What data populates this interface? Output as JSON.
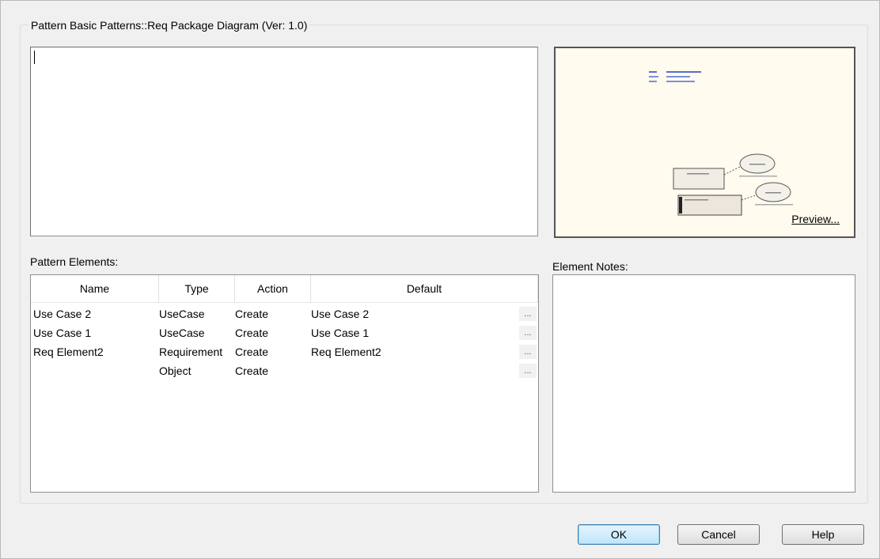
{
  "group": {
    "title": "Pattern Basic Patterns::Req Package Diagram (Ver: 1.0)"
  },
  "notes": {
    "value": ""
  },
  "preview": {
    "link_label": "Preview..."
  },
  "pattern_elements": {
    "label": "Pattern Elements:",
    "columns": [
      "Name",
      "Type",
      "Action",
      "Default"
    ],
    "rows": [
      {
        "name": "Use Case 2",
        "type": "UseCase",
        "action": "Create",
        "default": "Use Case 2",
        "more": "..."
      },
      {
        "name": "Use Case 1",
        "type": "UseCase",
        "action": "Create",
        "default": "Use Case 1",
        "more": "..."
      },
      {
        "name": "Req Element2",
        "type": "Requirement",
        "action": "Create",
        "default": "Req Element2",
        "more": "..."
      },
      {
        "name": "",
        "type": "Object",
        "action": "Create",
        "default": "",
        "more": "..."
      }
    ]
  },
  "element_notes": {
    "label": "Element Notes:"
  },
  "buttons": {
    "ok": "OK",
    "cancel": "Cancel",
    "help": "Help"
  }
}
